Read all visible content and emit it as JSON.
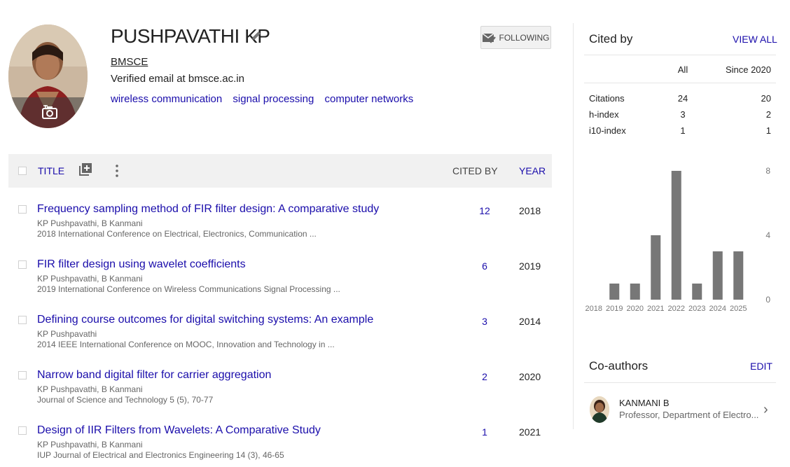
{
  "profile": {
    "name": "PUSHPAVATHI KP",
    "affiliation": "BMSCE",
    "email": "Verified email at bmsce.ac.in",
    "interests": [
      "wireless communication",
      "signal processing",
      "computer networks"
    ],
    "follow_label": "FOLLOWING"
  },
  "table": {
    "header_title": "TITLE",
    "header_cited": "CITED BY",
    "header_year": "YEAR",
    "rows": [
      {
        "title": "Frequency sampling method of FIR filter design: A comparative study",
        "authors": "KP Pushpavathi, B Kanmani",
        "venue": "2018 International Conference on Electrical, Electronics, Communication ...",
        "cited": "12",
        "year": "2018"
      },
      {
        "title": "FIR filter design using wavelet coefficients",
        "authors": "KP Pushpavathi, B Kanmani",
        "venue": "2019 International Conference on Wireless Communications Signal Processing ...",
        "cited": "6",
        "year": "2019"
      },
      {
        "title": "Defining course outcomes for digital switching systems: An example",
        "authors": "KP Pushpavathi",
        "venue": "2014 IEEE International Conference on MOOC, Innovation and Technology in ...",
        "cited": "3",
        "year": "2014"
      },
      {
        "title": "Narrow band digital filter for carrier aggregation",
        "authors": "KP Pushpavathi, B Kanmani",
        "venue": "Journal of Science and Technology 5 (5), 70-77",
        "cited": "2",
        "year": "2020"
      },
      {
        "title": "Design of IIR Filters from Wavelets: A Comparative Study",
        "authors": "KP Pushpavathi, B Kanmani",
        "venue": "IUP Journal of Electrical and Electronics Engineering 14 (3), 46-65",
        "cited": "1",
        "year": "2021"
      }
    ]
  },
  "cited_by": {
    "title": "Cited by",
    "view_all": "VIEW ALL",
    "col_all": "All",
    "col_since": "Since 2020",
    "rows": [
      {
        "label": "Citations",
        "all": "24",
        "since": "20"
      },
      {
        "label": "h-index",
        "all": "3",
        "since": "2"
      },
      {
        "label": "i10-index",
        "all": "1",
        "since": "1"
      }
    ]
  },
  "chart_data": {
    "type": "bar",
    "categories": [
      "2018",
      "2019",
      "2020",
      "2021",
      "2022",
      "2023",
      "2024",
      "2025"
    ],
    "values": [
      0,
      1,
      1,
      4,
      8,
      1,
      3,
      3
    ],
    "yticks": [
      "8",
      "4",
      "0"
    ],
    "ylim": [
      0,
      8
    ],
    "bar_color": "#777777"
  },
  "coauthors": {
    "title": "Co-authors",
    "edit": "EDIT",
    "items": [
      {
        "name": "KANMANI B",
        "affiliation": "Professor, Department of Electro..."
      }
    ]
  }
}
